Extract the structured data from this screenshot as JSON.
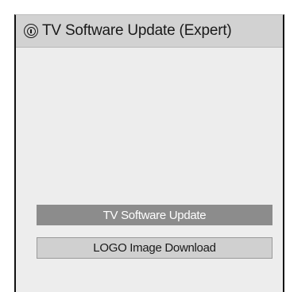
{
  "dialog": {
    "title": "TV Software Update (Expert)",
    "title_icon": "info-circle-icon"
  },
  "menu": {
    "items": [
      {
        "label": "TV Software Update",
        "selected": true
      },
      {
        "label": "LOGO Image Download",
        "selected": false
      }
    ]
  },
  "colors": {
    "header_bg": "#d2d2d2",
    "panel_bg": "#ededed",
    "selected_bg": "#8c8c8c",
    "selected_text": "#ffffff",
    "item_bg": "#d0d0d0",
    "text": "#1a1a1a"
  }
}
